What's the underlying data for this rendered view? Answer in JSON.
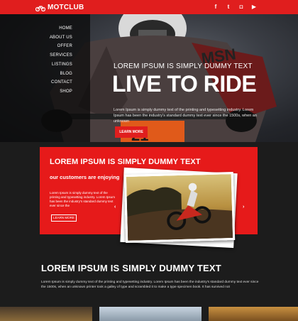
{
  "brand": {
    "name_light": "MOT",
    "name_bold": "CLUB"
  },
  "social": [
    {
      "name": "facebook-icon",
      "glyph": "f"
    },
    {
      "name": "twitter-icon",
      "glyph": "t"
    },
    {
      "name": "instagram-icon",
      "glyph": "◘"
    },
    {
      "name": "youtube-icon",
      "glyph": "▶"
    }
  ],
  "nav": [
    "HOME",
    "ABOUT US",
    "OFFER",
    "SERVICES",
    "LISTINGS",
    "BLOG",
    "CONTACT",
    "SHOP"
  ],
  "hero": {
    "subtitle": "LOREM IPSUM IS SIMPLY DUMMY TEXT",
    "title": "LIVE TO RIDE",
    "text": "Lorem Ipsum is simply dummy text of the printing and typesetting industry. Lorem Ipsum has been the industry's standard dummy text ever since the 1500s, when an unknown",
    "button": "LEARN MORE"
  },
  "feature": {
    "title": "LOREM IPSUM IS SIMPLY DUMMY TEXT",
    "subtitle": "our customers are enjoying",
    "text": "Lorem Ipsum is simply dummy text of the printing and typesetting industry. Lorem Ipsum has been the industry's standard dummy text ever since the",
    "button": "LEARN MORE",
    "prev": "‹",
    "next": "›"
  },
  "about": {
    "title": "LOREM IPSUM IS SIMPLY DUMMY TEXT",
    "text": "Lorem Ipsum is simply dummy text of the printing and typesetting industry. Lorem Ipsum has been the industry's standard dummy text ever since the 1500s, when an unknown printer took a galley of type and scrambled it to make a type specimen book. It has survived not"
  },
  "colors": {
    "accent": "#e01e1e",
    "background": "#1c1c1c"
  }
}
